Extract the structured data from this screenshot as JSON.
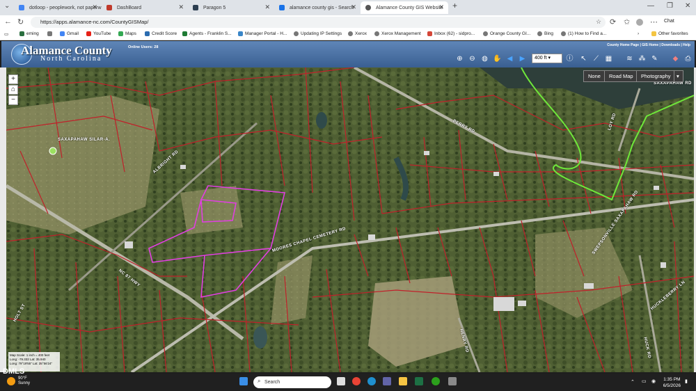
{
  "browser": {
    "tabs": [
      {
        "label": "dotloop - peoplework, not paperw",
        "color": "#4285f4"
      },
      {
        "label": "DashBoard",
        "color": "#c0392b"
      },
      {
        "label": "Paragon 5",
        "color": "#2c3e50"
      },
      {
        "label": "alamance county gis - Search",
        "color": "#1a73e8"
      },
      {
        "label": "Alamance County GIS Website",
        "color": "#555555"
      }
    ],
    "new_tab": "+",
    "url": "https://apps.alamance-nc.com/CountyGISMap/",
    "favorites": [
      "eming",
      "Gmail",
      "YouTube",
      "Maps",
      "Credit Score",
      "Agents - Franklin S...",
      "Manager Portal - H...",
      "Updating IP Settings",
      "Xerox",
      "Xerox Management",
      "Inbox (62) - sidpro...",
      "Orange County GI...",
      "Bing",
      "(1) How to Find a..."
    ],
    "other_favorites": "Other favorites",
    "chat": "Chat"
  },
  "gis": {
    "title": "Alamance County",
    "subtitle": "North Carolina",
    "online_users": "Online Users: 28",
    "links": "County Home Page | GIS Home | Downloads | Help",
    "scale_value": "400 ft",
    "basemaps": [
      "None",
      "Road Map",
      "Photography"
    ],
    "colors": {
      "parcel": "#c0202a",
      "selected": "#e040e0",
      "stream": "#6fe83a"
    }
  },
  "map": {
    "labels": [
      "SAXAPAHAW SILAR-A.",
      "ALBRIGHT RD",
      "PERRY RD",
      "SAXAPAHAW RD",
      "MOORES CHAPEL CEMETERY RD",
      "LOY RD",
      "NC 87 HWY",
      "HOLT ST",
      "SWEPSONVILLE SAXAPAHAW RD",
      "HENRY RD",
      "HUCK RD",
      "HUCKLEBERRY LN"
    ],
    "scale_text": "Map Scale: 1 inch = 400 feet",
    "coords_1": "Long: -79.332  Lat: 35.940",
    "coords_2": "Long: 79°19'55\"  Lat: 35°56'24\""
  },
  "taskbar": {
    "temperature": "90°F",
    "condition": "Sunny",
    "search": "Search",
    "time": "1:35 PM",
    "date": "6/5/2026",
    "watermark": "DMLS"
  }
}
